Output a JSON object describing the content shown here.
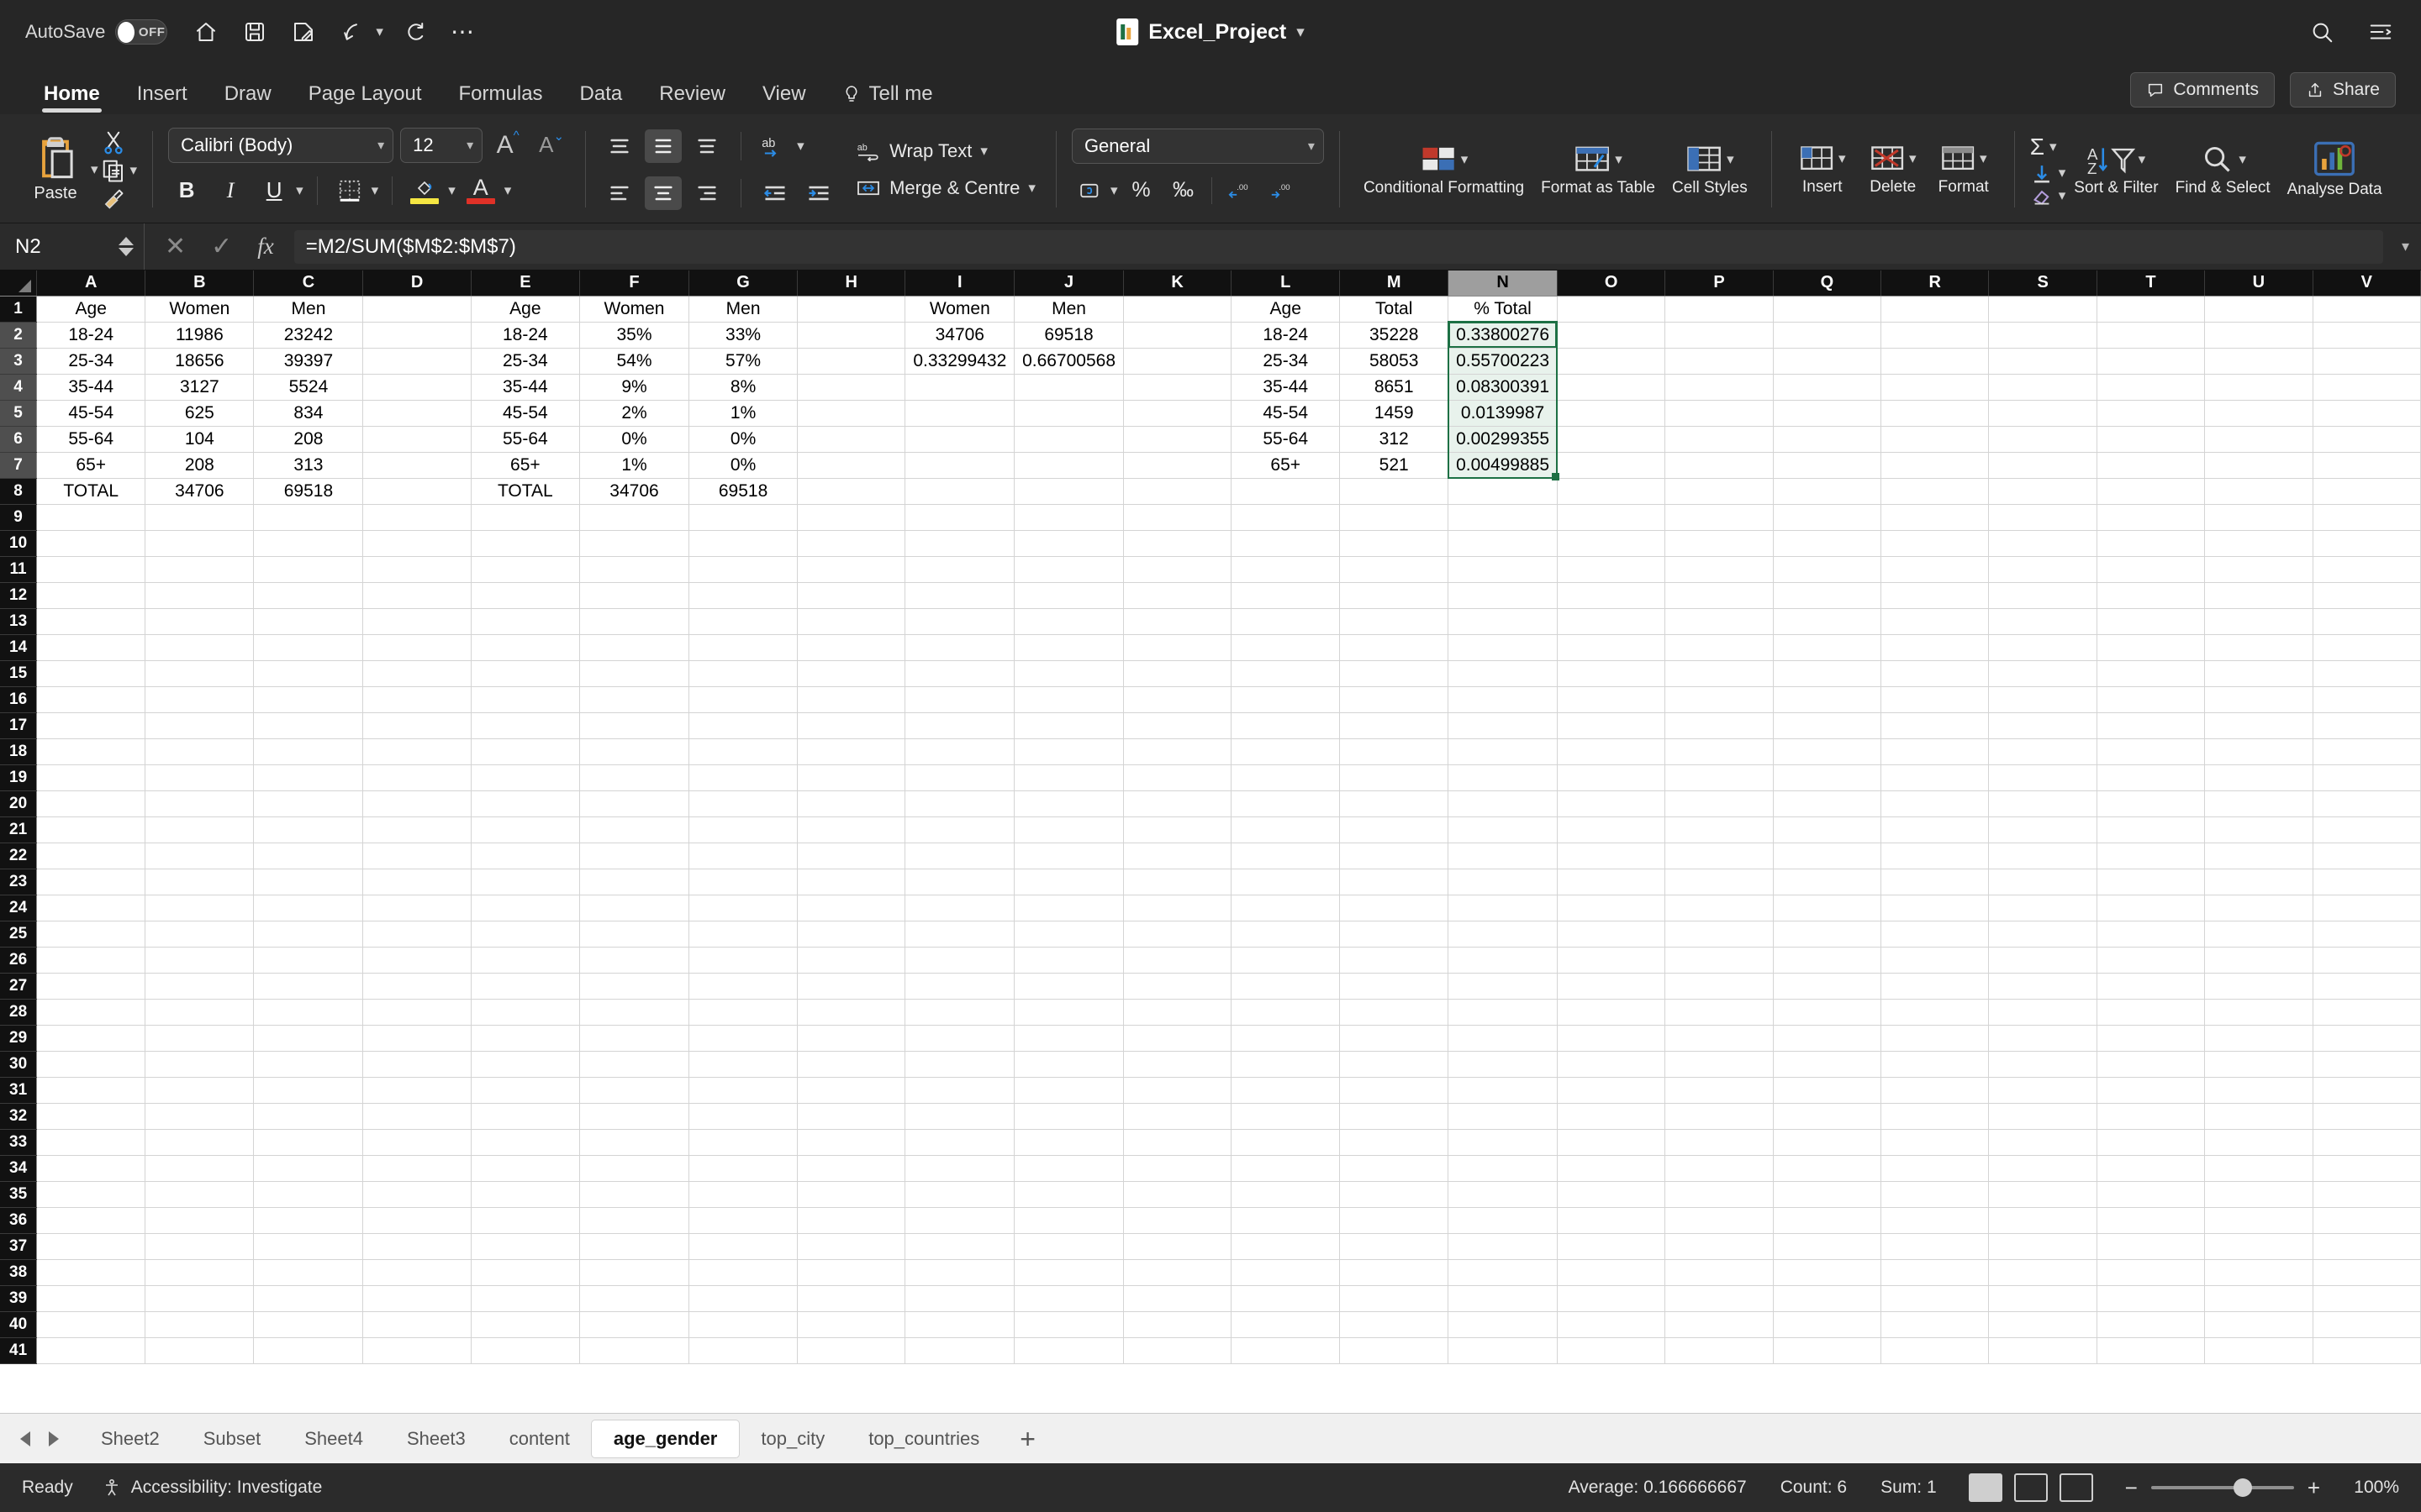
{
  "titlebar": {
    "autosave_label": "AutoSave",
    "autosave_state": "OFF",
    "document_title": "Excel_Project",
    "quick_access": [
      "home-icon",
      "save-icon",
      "save-as-icon",
      "undo-icon",
      "redo-icon",
      "more-icon"
    ],
    "search_icon": "search-icon",
    "ribbon_display_icon": "ribbon-display-icon"
  },
  "ribbon_tabs": [
    {
      "label": "Home",
      "active": true
    },
    {
      "label": "Insert",
      "active": false
    },
    {
      "label": "Draw",
      "active": false
    },
    {
      "label": "Page Layout",
      "active": false
    },
    {
      "label": "Formulas",
      "active": false
    },
    {
      "label": "Data",
      "active": false
    },
    {
      "label": "Review",
      "active": false
    },
    {
      "label": "View",
      "active": false
    }
  ],
  "tell_me": "Tell me",
  "comments_label": "Comments",
  "share_label": "Share",
  "ribbon": {
    "paste_label": "Paste",
    "font_name": "Calibri (Body)",
    "font_size": "12",
    "grow_font": "A",
    "shrink_font": "A",
    "bold": "B",
    "italic": "I",
    "underline": "U",
    "wrap_text": "Wrap Text",
    "merge_centre": "Merge & Centre",
    "number_format": "General",
    "percent": "%",
    "comma": "‰",
    "conditional_formatting": "Conditional Formatting",
    "format_as_table": "Format as Table",
    "cell_styles": "Cell Styles",
    "insert": "Insert",
    "delete": "Delete",
    "format": "Format",
    "sort_filter": "Sort & Filter",
    "find_select": "Find & Select",
    "analyse_data": "Analyse Data",
    "highlight_color": "#f5e642",
    "font_color": "#e03127",
    "accent_blue": "#2b8ce6",
    "paste_gold": "#e8a33d"
  },
  "formula_bar": {
    "name_box": "N2",
    "cancel_icon": "close-icon",
    "enter_icon": "check-icon",
    "function_icon": "fx-icon",
    "formula": "=M2/SUM($M$2:$M$7)"
  },
  "grid": {
    "columns": [
      "A",
      "B",
      "C",
      "D",
      "E",
      "F",
      "G",
      "H",
      "I",
      "J",
      "K",
      "L",
      "M",
      "N",
      "O",
      "P",
      "Q",
      "R",
      "S",
      "T",
      "U",
      "V"
    ],
    "selected_column": "N",
    "row_count": 41,
    "cells": {
      "A1": "Age",
      "B1": "Women",
      "C1": "Men",
      "E1": "Age",
      "F1": "Women",
      "G1": "Men",
      "I1": "Women",
      "J1": "Men",
      "L1": "Age",
      "M1": "Total",
      "N1": "% Total",
      "A2": "18-24",
      "B2": "11986",
      "C2": "23242",
      "E2": "18-24",
      "F2": "35%",
      "G2": "33%",
      "I2": "34706",
      "J2": "69518",
      "L2": "18-24",
      "M2": "35228",
      "N2": "0.33800276",
      "A3": "25-34",
      "B3": "18656",
      "C3": "39397",
      "E3": "25-34",
      "F3": "54%",
      "G3": "57%",
      "I3": "0.33299432",
      "J3": "0.66700568",
      "L3": "25-34",
      "M3": "58053",
      "N3": "0.55700223",
      "A4": "35-44",
      "B4": "3127",
      "C4": "5524",
      "E4": "35-44",
      "F4": "9%",
      "G4": "8%",
      "L4": "35-44",
      "M4": "8651",
      "N4": "0.08300391",
      "A5": "45-54",
      "B5": "625",
      "C5": "834",
      "E5": "45-54",
      "F5": "2%",
      "G5": "1%",
      "L5": "45-54",
      "M5": "1459",
      "N5": "0.0139987",
      "A6": "55-64",
      "B6": "104",
      "C6": "208",
      "E6": "55-64",
      "F6": "0%",
      "G6": "0%",
      "L6": "55-64",
      "M6": "312",
      "N6": "0.00299355",
      "A7": "65+",
      "B7": "208",
      "C7": "313",
      "E7": "65+",
      "F7": "1%",
      "G7": "0%",
      "L7": "65+",
      "M7": "521",
      "N7": "0.00499885",
      "A8": "TOTAL",
      "B8": "34706",
      "C8": "69518",
      "E8": "TOTAL",
      "F8": "34706",
      "G8": "69518"
    }
  },
  "sheet_tabs": [
    {
      "label": "Sheet2",
      "active": false
    },
    {
      "label": "Subset",
      "active": false
    },
    {
      "label": "Sheet4",
      "active": false
    },
    {
      "label": "Sheet3",
      "active": false
    },
    {
      "label": "content",
      "active": false
    },
    {
      "label": "age_gender",
      "active": true
    },
    {
      "label": "top_city",
      "active": false
    },
    {
      "label": "top_countries",
      "active": false
    }
  ],
  "add_sheet": "+",
  "status_bar": {
    "ready": "Ready",
    "accessibility": "Accessibility: Investigate",
    "average": "Average: 0.166666667",
    "count": "Count: 6",
    "sum": "Sum: 1",
    "zoom": "100%"
  }
}
